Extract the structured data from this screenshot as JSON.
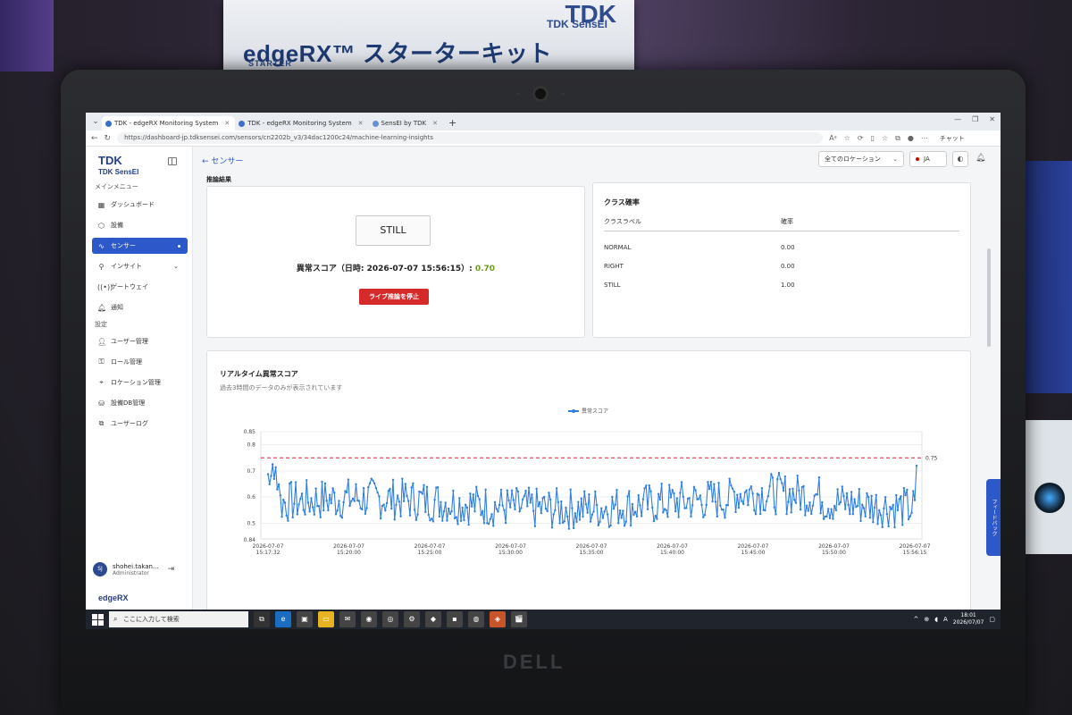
{
  "background_sign": {
    "tdk": "TDK",
    "sensei": "TDK SensEI",
    "brand": "edgeRX™ スターターキット",
    "brand_logo": "RX",
    "starter": "STARTER"
  },
  "laptop_brand": "DELL",
  "browser": {
    "tabs": [
      {
        "label": "TDK - edgeRX Monitoring System",
        "active": true
      },
      {
        "label": "TDK - edgeRX Monitoring System",
        "active": false
      },
      {
        "label": "SensEI by TDK",
        "active": false
      }
    ],
    "url": "https://dashboard-jp.tdksensei.com/sensors/cn2202b_v3/34dac1200c24/machine-learning-insights",
    "chat_label": "チャット"
  },
  "sidebar": {
    "logo_line1": "TDK",
    "logo_line2": "TDK SensEI",
    "main_menu_label": "メインメニュー",
    "items": [
      {
        "label": "ダッシュボード",
        "icon": "grid-icon"
      },
      {
        "label": "設備",
        "icon": "box-icon"
      },
      {
        "label": "センサー",
        "icon": "pulse-icon",
        "active": true
      },
      {
        "label": "インサイト",
        "icon": "insight-icon"
      },
      {
        "label": "ゲートウェイ",
        "icon": "gateway-icon"
      },
      {
        "label": "通知",
        "icon": "bell-icon"
      }
    ],
    "settings_label": "設定",
    "settings_items": [
      {
        "label": "ユーザー管理",
        "icon": "user-icon"
      },
      {
        "label": "ロール管理",
        "icon": "key-icon"
      },
      {
        "label": "ロケーション管理",
        "icon": "pin-icon"
      },
      {
        "label": "設備DB管理",
        "icon": "db-icon"
      },
      {
        "label": "ユーザーログ",
        "icon": "log-icon"
      }
    ],
    "user_initials": "SJ",
    "user_name": "shohei.takan...",
    "user_role": "Administrator",
    "footer_logo": "edgeRX"
  },
  "topbar": {
    "back_label": "← センサー",
    "location_select": "全てのロケーション",
    "language": "JA"
  },
  "inference": {
    "section_title": "推論結果",
    "class_label": "STILL",
    "score_text": "異常スコア（日時: 2026-07-07 15:56:15）:",
    "score_value": "0.70",
    "stop_button": "ライブ推論を停止"
  },
  "class_prob": {
    "title": "クラス確率",
    "col_label": "クラスラベル",
    "col_prob": "確率",
    "rows": [
      {
        "label": "NORMAL",
        "prob": "0.00"
      },
      {
        "label": "RIGHT",
        "prob": "0.00"
      },
      {
        "label": "STILL",
        "prob": "1.00"
      }
    ]
  },
  "realtime": {
    "title": "リアルタイム異常スコア",
    "subtitle": "過去3時間のデータのみが表示されています"
  },
  "chart_data": {
    "type": "line",
    "series": [
      {
        "name": "異常スコア",
        "color": "#2f7fe0"
      }
    ],
    "y_ticks": [
      0.84,
      0.5,
      0.6,
      0.7,
      0.8,
      0.85
    ],
    "y_tick_labels": [
      "0.5",
      "0.6",
      "0.7",
      "0.8",
      "0.85"
    ],
    "bottom_label": "0.84",
    "ylim": [
      0.44,
      0.85
    ],
    "threshold": 0.75,
    "threshold_label": "0.75",
    "x_ticks": [
      {
        "date": "2026-07-07",
        "time": "15:17:32"
      },
      {
        "date": "2026-07-07",
        "time": "15:20:00"
      },
      {
        "date": "2026-07-07",
        "time": "15:25:00"
      },
      {
        "date": "2026-07-07",
        "time": "15:30:00"
      },
      {
        "date": "2026-07-07",
        "time": "15:35:00"
      },
      {
        "date": "2026-07-07",
        "time": "15:40:00"
      },
      {
        "date": "2026-07-07",
        "time": "15:45:00"
      },
      {
        "date": "2026-07-07",
        "time": "15:50:00"
      },
      {
        "date": "2026-07-07",
        "time": "15:56:15"
      }
    ]
  },
  "feedback_label": "フィードバック",
  "taskbar": {
    "search_placeholder": "ここに入力して検索",
    "time": "18:01",
    "date": "2026/07/07",
    "ime": "A"
  }
}
